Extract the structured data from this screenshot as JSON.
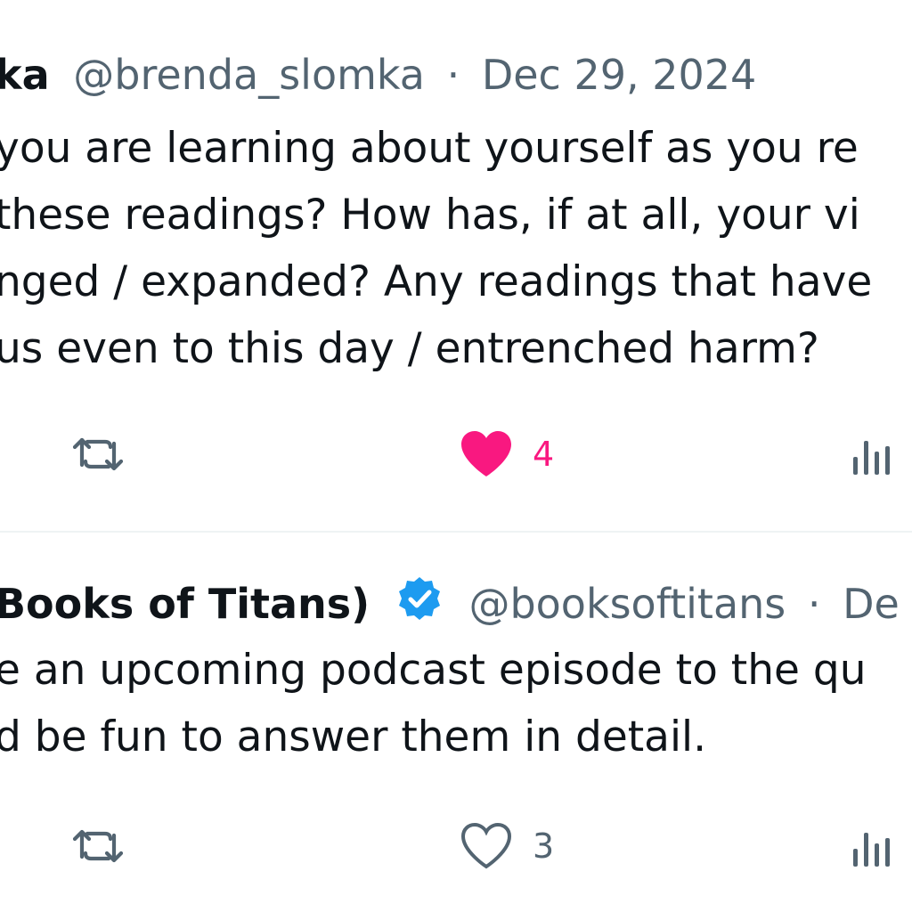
{
  "tweets": [
    {
      "name": "ka",
      "handle": "@brenda_slomka",
      "separator": "·",
      "date": "Dec 29, 2024",
      "verified": false,
      "body_lines": [
        "you are learning about yourself as you re",
        "these readings? How has, if at all, your vi",
        "nged / expanded? Any readings that have",
        "us even to this day / entrenched harm?"
      ],
      "actions": {
        "like_count": "4",
        "liked": true
      }
    },
    {
      "name": "Books of Titans)",
      "handle": "@booksoftitans",
      "separator": "·",
      "date": "De",
      "verified": true,
      "body_lines": [
        "e an upcoming podcast episode to the qu",
        "d be fun to answer them in detail."
      ],
      "actions": {
        "like_count": "3",
        "liked": false
      }
    }
  ],
  "icons": {
    "retweet": "retweet-icon",
    "like": "heart-icon",
    "views": "views-bar-chart-icon",
    "verified": "verified-badge-icon"
  },
  "colors": {
    "text": "#0f1419",
    "muted": "#536471",
    "like_active": "#f91880",
    "verified": "#1d9bf0"
  }
}
